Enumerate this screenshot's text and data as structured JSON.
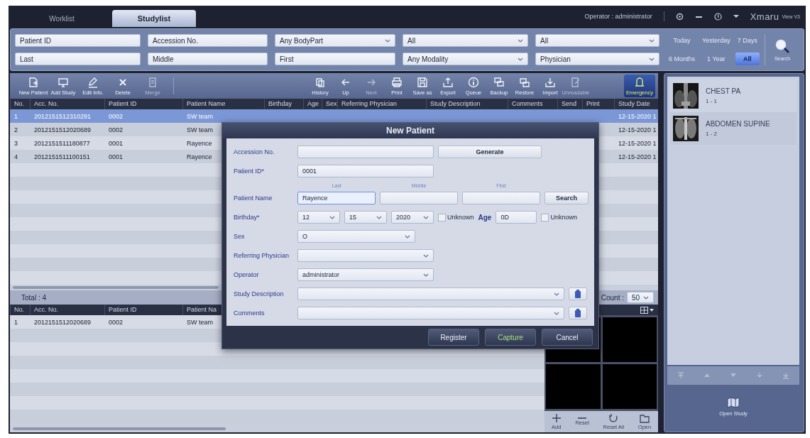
{
  "top_bar": {
    "tabs": [
      {
        "label": "Worklist",
        "selected": false
      },
      {
        "label": "Studylist",
        "selected": true
      }
    ],
    "operator": "Operator : administrator",
    "logo": "Xmaru",
    "version": "View V3"
  },
  "filters": {
    "fields": [
      {
        "kind": "text",
        "placeholder": "Patient ID"
      },
      {
        "kind": "text",
        "placeholder": "Accession No."
      },
      {
        "kind": "select",
        "value": "Any BodyPart"
      },
      {
        "kind": "select",
        "value": "All"
      },
      {
        "kind": "select",
        "value": "All"
      },
      {
        "kind": "text",
        "placeholder": "Last"
      },
      {
        "kind": "text",
        "placeholder": "Middle"
      },
      {
        "kind": "text",
        "placeholder": "First"
      },
      {
        "kind": "select",
        "value": "Any Modality"
      },
      {
        "kind": "select",
        "value": "Physician"
      }
    ],
    "date_ranges": [
      {
        "label": "Today",
        "selected": false
      },
      {
        "label": "Yesterday",
        "selected": false
      },
      {
        "label": "7 Days",
        "selected": false
      },
      {
        "label": "6 Months",
        "selected": false
      },
      {
        "label": "1 Year",
        "selected": false
      },
      {
        "label": "All",
        "selected": true
      }
    ],
    "search_button": "Search"
  },
  "toolbar": {
    "left": [
      {
        "label": "New Patient",
        "disabled": false
      },
      {
        "label": "Add Study",
        "disabled": false
      },
      {
        "label": "Edit Info.",
        "disabled": false
      },
      {
        "label": "Delete",
        "disabled": false
      },
      {
        "label": "Merge",
        "disabled": true
      }
    ],
    "right": [
      {
        "label": "History",
        "disabled": false,
        "highlighted": false
      },
      {
        "label": "Up",
        "disabled": false,
        "highlighted": false
      },
      {
        "label": "Next",
        "disabled": true,
        "highlighted": false
      },
      {
        "label": "Print",
        "disabled": false,
        "highlighted": false
      },
      {
        "label": "Save as",
        "disabled": false,
        "highlighted": false
      },
      {
        "label": "Export",
        "disabled": false,
        "highlighted": false
      },
      {
        "label": "Queue",
        "disabled": false,
        "highlighted": false
      },
      {
        "label": "Backup",
        "disabled": false,
        "highlighted": false
      },
      {
        "label": "Restore",
        "disabled": false,
        "highlighted": false
      },
      {
        "label": "Import",
        "disabled": false,
        "highlighted": false
      },
      {
        "label": "Unreadable",
        "disabled": true,
        "highlighted": false
      },
      {
        "label": "Emergency",
        "disabled": false,
        "highlighted": true
      }
    ]
  },
  "study_table": {
    "columns": [
      "No.",
      "Acc. No.",
      "Patient ID",
      "Patient Name",
      "Birthday",
      "Age",
      "Sex",
      "Referring Physician",
      "Study Description",
      "Comments",
      "Send",
      "Print",
      "Study Date"
    ],
    "rows": [
      {
        "no": "1",
        "acc_no": "2012151512310291",
        "patient_id": "0002",
        "patient_name": "SW team",
        "study_date": "12-15-2020 1",
        "selected": true
      },
      {
        "no": "2",
        "acc_no": "2012151512020689",
        "patient_id": "0002",
        "patient_name": "SW team",
        "study_date": "12-15-2020 1",
        "selected": false
      },
      {
        "no": "3",
        "acc_no": "2012151511180877",
        "patient_id": "0001",
        "patient_name": "Rayence",
        "study_date": "12-15-2020 1",
        "selected": false
      },
      {
        "no": "4",
        "acc_no": "2012151511100151",
        "patient_id": "0001",
        "patient_name": "Rayence",
        "study_date": "12-15-2020 1",
        "selected": false
      }
    ]
  },
  "total": "Total : 4",
  "count": {
    "label": "Count :",
    "value": "50"
  },
  "lower_table": {
    "columns": [
      "No.",
      "Acc. No.",
      "Patient ID",
      "Patient Na"
    ],
    "rows": [
      {
        "no": "1",
        "acc_no": "2012151512020689",
        "patient_id": "0002",
        "patient_name": "SW team",
        "selected": false
      }
    ]
  },
  "viewer": {
    "tools": [
      "Add",
      "Reset",
      "Reset All",
      "Open"
    ]
  },
  "series_panel": {
    "items": [
      {
        "title": "CHEST PA",
        "number": "1 - 1"
      },
      {
        "title": "ABDOMEN SUPINE",
        "number": "1 - 2"
      }
    ],
    "open_study": "Open Study"
  },
  "dialog": {
    "title": "New Patient",
    "accession_no": {
      "label": "Accession No."
    },
    "generate_button": "Generate",
    "patient_id": {
      "label": "Patient ID*",
      "value": "0001"
    },
    "name_parts": [
      "Last",
      "Middle",
      "First"
    ],
    "patient_name": {
      "label": "Patient Name",
      "fields": [
        {
          "value": "Rayence",
          "focused": true
        },
        {
          "focused": false
        },
        {
          "focused": false
        }
      ]
    },
    "search_button": "Search",
    "birthday": {
      "label": "Birthday*",
      "month": "12",
      "day": "15",
      "year": "2020",
      "unknown": {
        "label": "Unknown",
        "checked": false
      }
    },
    "age": {
      "label": "Age",
      "value": "0D",
      "unknown": {
        "label": "Unknown",
        "checked": false
      }
    },
    "sex": {
      "label": "Sex",
      "value": "O"
    },
    "referring_physician": {
      "label": "Referring Physician"
    },
    "operator": {
      "label": "Operator",
      "value": "administrator"
    },
    "study_description": {
      "label": "Study Description"
    },
    "comments": {
      "label": "Comments"
    },
    "buttons": [
      {
        "label": "Register",
        "kind": "normal"
      },
      {
        "label": "Capture",
        "kind": "capture"
      },
      {
        "label": "Cancel",
        "kind": "normal"
      }
    ]
  }
}
